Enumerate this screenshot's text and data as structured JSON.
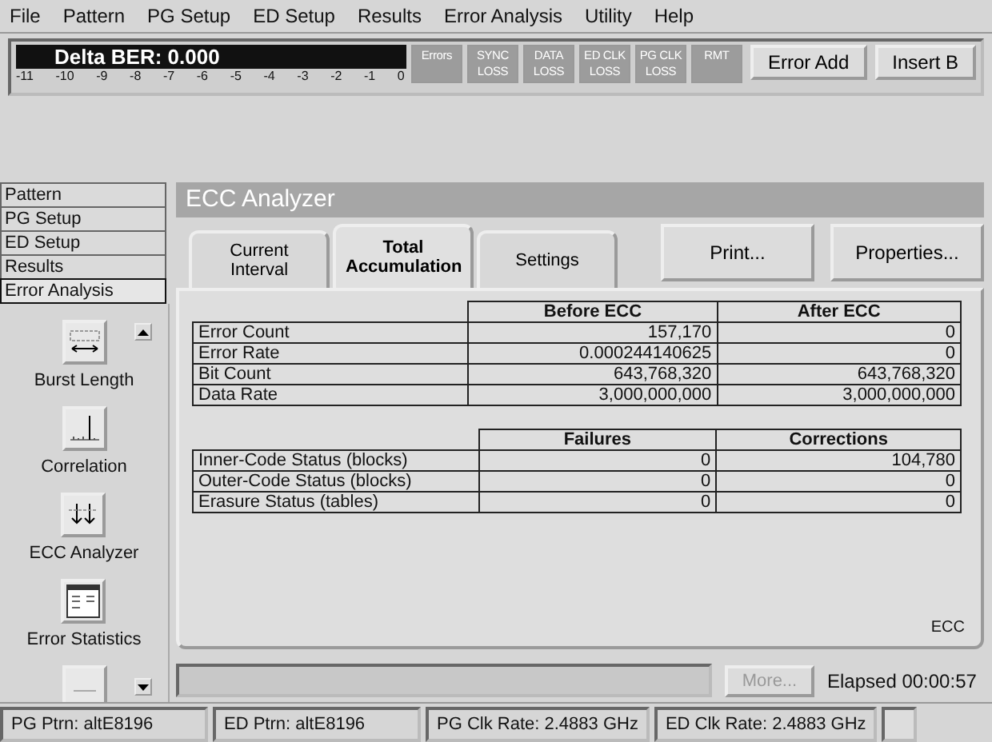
{
  "menu": [
    "File",
    "Pattern",
    "PG Setup",
    "ED Setup",
    "Results",
    "Error Analysis",
    "Utility",
    "Help"
  ],
  "ber_display": {
    "title": "Delta BER: 0.000",
    "scale": [
      "-11",
      "-10",
      "-9",
      "-8",
      "-7",
      "-6",
      "-5",
      "-4",
      "-3",
      "-2",
      "-1",
      "0"
    ]
  },
  "indicators": [
    {
      "label": "Errors",
      "on": false
    },
    {
      "label": "SYNC LOSS",
      "on": false
    },
    {
      "label": "DATA LOSS",
      "on": false
    },
    {
      "label": "ED CLK LOSS",
      "on": false
    },
    {
      "label": "PG CLK LOSS",
      "on": false
    },
    {
      "label": "RMT",
      "on": false
    }
  ],
  "toolbar_buttons": [
    "Error Add",
    "Insert B"
  ],
  "nav_tabs": [
    {
      "label": "Pattern",
      "selected": false
    },
    {
      "label": "PG Setup",
      "selected": false
    },
    {
      "label": "ED Setup",
      "selected": false
    },
    {
      "label": "Results",
      "selected": false
    },
    {
      "label": "Error Analysis",
      "selected": true
    }
  ],
  "tools": [
    {
      "label": "Burst Length",
      "kind": "burst"
    },
    {
      "label": "Correlation",
      "kind": "correlation"
    },
    {
      "label": "ECC Analyzer",
      "kind": "ecc"
    },
    {
      "label": "Error Statistics",
      "kind": "statistics"
    },
    {
      "kind": "partial"
    }
  ],
  "page_title": "ECC Analyzer",
  "tabs": [
    {
      "label": "Current Interval",
      "selected": false
    },
    {
      "label": "Total Accumulation",
      "selected": true
    },
    {
      "label": "Settings",
      "selected": false
    }
  ],
  "actions": [
    "Print...",
    "Properties..."
  ],
  "ecc_table": {
    "columns": [
      "Before ECC",
      "After ECC"
    ],
    "rows": [
      {
        "label": "Error Count",
        "values": [
          "157,170",
          "0"
        ]
      },
      {
        "label": "Error Rate",
        "values": [
          "0.000244140625",
          "0"
        ]
      },
      {
        "label": "Bit Count",
        "values": [
          "643,768,320",
          "643,768,320"
        ]
      },
      {
        "label": "Data Rate",
        "values": [
          "3,000,000,000",
          "3,000,000,000"
        ]
      }
    ]
  },
  "status_table": {
    "columns": [
      "Failures",
      "Corrections"
    ],
    "rows": [
      {
        "label": "Inner-Code Status (blocks)",
        "values": [
          "0",
          "104,780"
        ]
      },
      {
        "label": "Outer-Code Status (blocks)",
        "values": [
          "0",
          "0"
        ]
      },
      {
        "label": "Erasure Status (tables)",
        "values": [
          "0",
          "0"
        ]
      }
    ]
  },
  "panel_label": "ECC",
  "more_button": {
    "label": "More...",
    "disabled": true
  },
  "elapsed": "Elapsed 00:00:57",
  "status_bar": [
    "PG Ptrn: altE8196",
    "ED Ptrn: altE8196",
    "PG Clk Rate: 2.4883 GHz",
    "ED Clk Rate: 2.4883 GHz"
  ]
}
